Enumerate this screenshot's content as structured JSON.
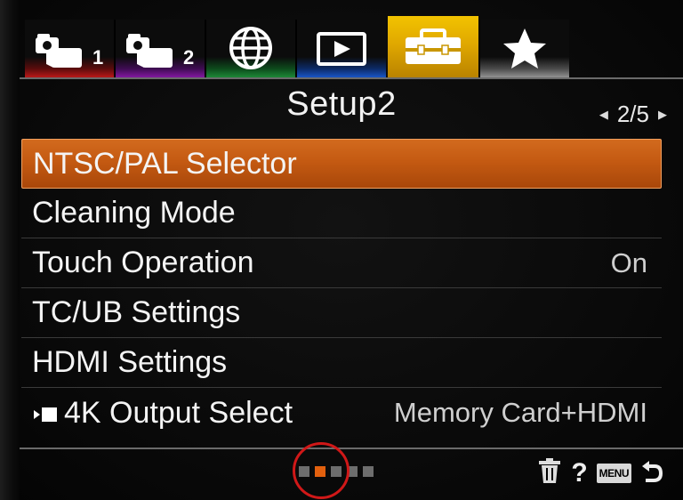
{
  "tabs": [
    {
      "icon": "camera-icon",
      "number": "1",
      "color": "#c41a1a",
      "active": false
    },
    {
      "icon": "camera-icon",
      "number": "2",
      "color": "#8a1aa8",
      "active": false
    },
    {
      "icon": "globe-icon",
      "number": "",
      "color": "#1f8f3a",
      "active": false
    },
    {
      "icon": "playback-icon",
      "number": "",
      "color": "#1a5ad0",
      "active": false
    },
    {
      "icon": "toolbox-icon",
      "number": "",
      "color": "#f2c300",
      "active": true
    },
    {
      "icon": "star-icon",
      "number": "",
      "color": "#9a9a9a",
      "active": false
    }
  ],
  "header": {
    "title": "Setup2",
    "page": "2/5"
  },
  "menu": {
    "items": [
      {
        "label": "NTSC/PAL Selector",
        "value": "",
        "selected": true
      },
      {
        "label": "Cleaning Mode",
        "value": "",
        "selected": false
      },
      {
        "label": "Touch Operation",
        "value": "On",
        "selected": false
      },
      {
        "label": "TC/UB Settings",
        "value": "",
        "selected": false
      },
      {
        "label": "HDMI Settings",
        "value": "",
        "selected": false
      },
      {
        "label": "4K Output Select",
        "value": "Memory Card+HDMI",
        "selected": false,
        "icon": "movie-icon"
      }
    ]
  },
  "footer": {
    "page_dots": 5,
    "active_dot": 1,
    "help": "?",
    "menu_button": "MENU"
  },
  "colors": {
    "selection": "#c45a12",
    "active_tab": "#f2c300",
    "highlight_circle": "#d01818"
  }
}
